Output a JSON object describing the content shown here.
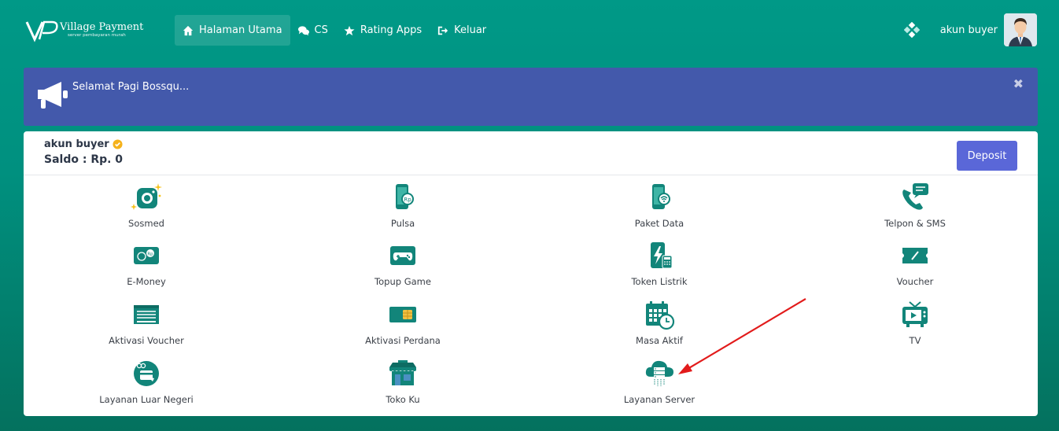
{
  "brand": {
    "name": "Village Payment",
    "tagline": "server pembayaran murah"
  },
  "nav": [
    {
      "label": "Halaman Utama",
      "icon": "home-icon"
    },
    {
      "label": "CS",
      "icon": "chat-icon"
    },
    {
      "label": "Rating Apps",
      "icon": "star-icon"
    },
    {
      "label": "Keluar",
      "icon": "logout-icon"
    }
  ],
  "user": {
    "name": "akun buyer"
  },
  "alert": {
    "text": "Selamat Pagi Bossqu...",
    "close": "✖"
  },
  "account": {
    "name": "akun buyer",
    "saldo": "Saldo : Rp. 0",
    "deposit_label": "Deposit"
  },
  "menu": [
    {
      "label": "Sosmed",
      "icon": "camera-icon"
    },
    {
      "label": "Pulsa",
      "icon": "phone-rp-icon"
    },
    {
      "label": "Paket Data",
      "icon": "phone-wifi-icon"
    },
    {
      "label": "Telpon & SMS",
      "icon": "phone-chat-icon"
    },
    {
      "label": "E-Money",
      "icon": "emoney-icon"
    },
    {
      "label": "Topup Game",
      "icon": "gamepad-icon"
    },
    {
      "label": "Token Listrik",
      "icon": "lightning-icon"
    },
    {
      "label": "Voucher",
      "icon": "ticket-icon"
    },
    {
      "label": "Aktivasi Voucher",
      "icon": "voucher-card-icon"
    },
    {
      "label": "Aktivasi Perdana",
      "icon": "simcard-icon"
    },
    {
      "label": "Masa Aktif",
      "icon": "calendar-clock-icon"
    },
    {
      "label": "TV",
      "icon": "tv-icon"
    },
    {
      "label": "Layanan Luar Negeri",
      "icon": "globe-icon"
    },
    {
      "label": "Toko Ku",
      "icon": "store-icon"
    },
    {
      "label": "Layanan Server",
      "icon": "cloud-server-icon"
    }
  ],
  "colors": {
    "primary": "#009987",
    "alert": "#4359ab",
    "deposit": "#5a67d8",
    "arrow": "#e21b1b"
  }
}
